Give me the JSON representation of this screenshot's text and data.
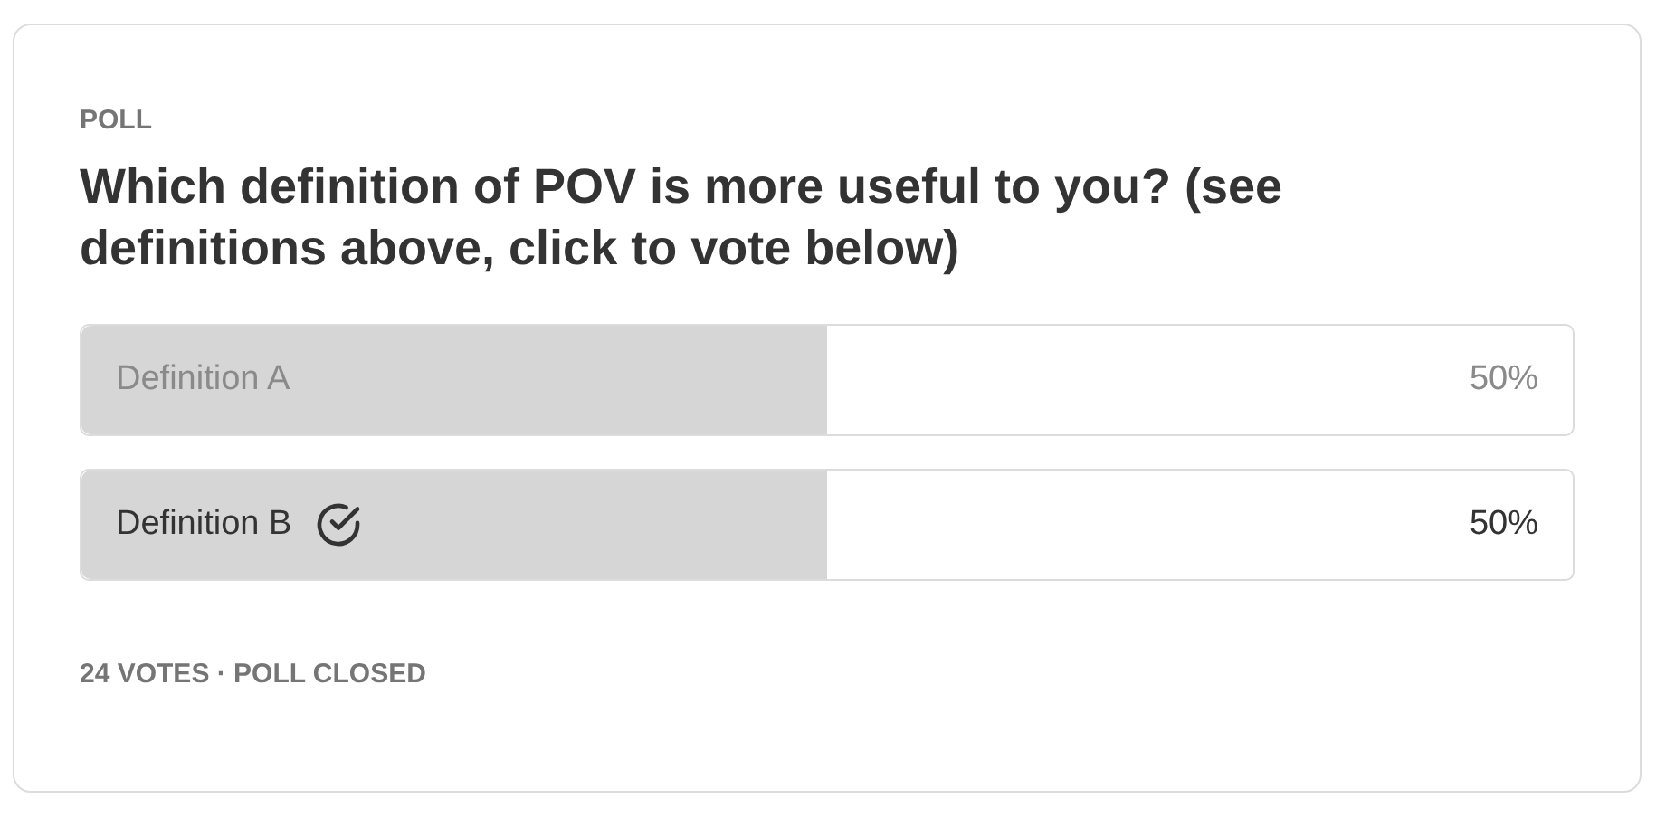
{
  "poll": {
    "label": "POLL",
    "question": "Which definition of POV is more useful to you? (see definitions above, click to vote below)",
    "options": [
      {
        "label": "Definition A",
        "percent": "50%",
        "level": 0.5,
        "selected": false
      },
      {
        "label": "Definition B",
        "percent": "50%",
        "level": 0.5,
        "selected": true
      }
    ],
    "footer": "24 VOTES · POLL CLOSED"
  }
}
